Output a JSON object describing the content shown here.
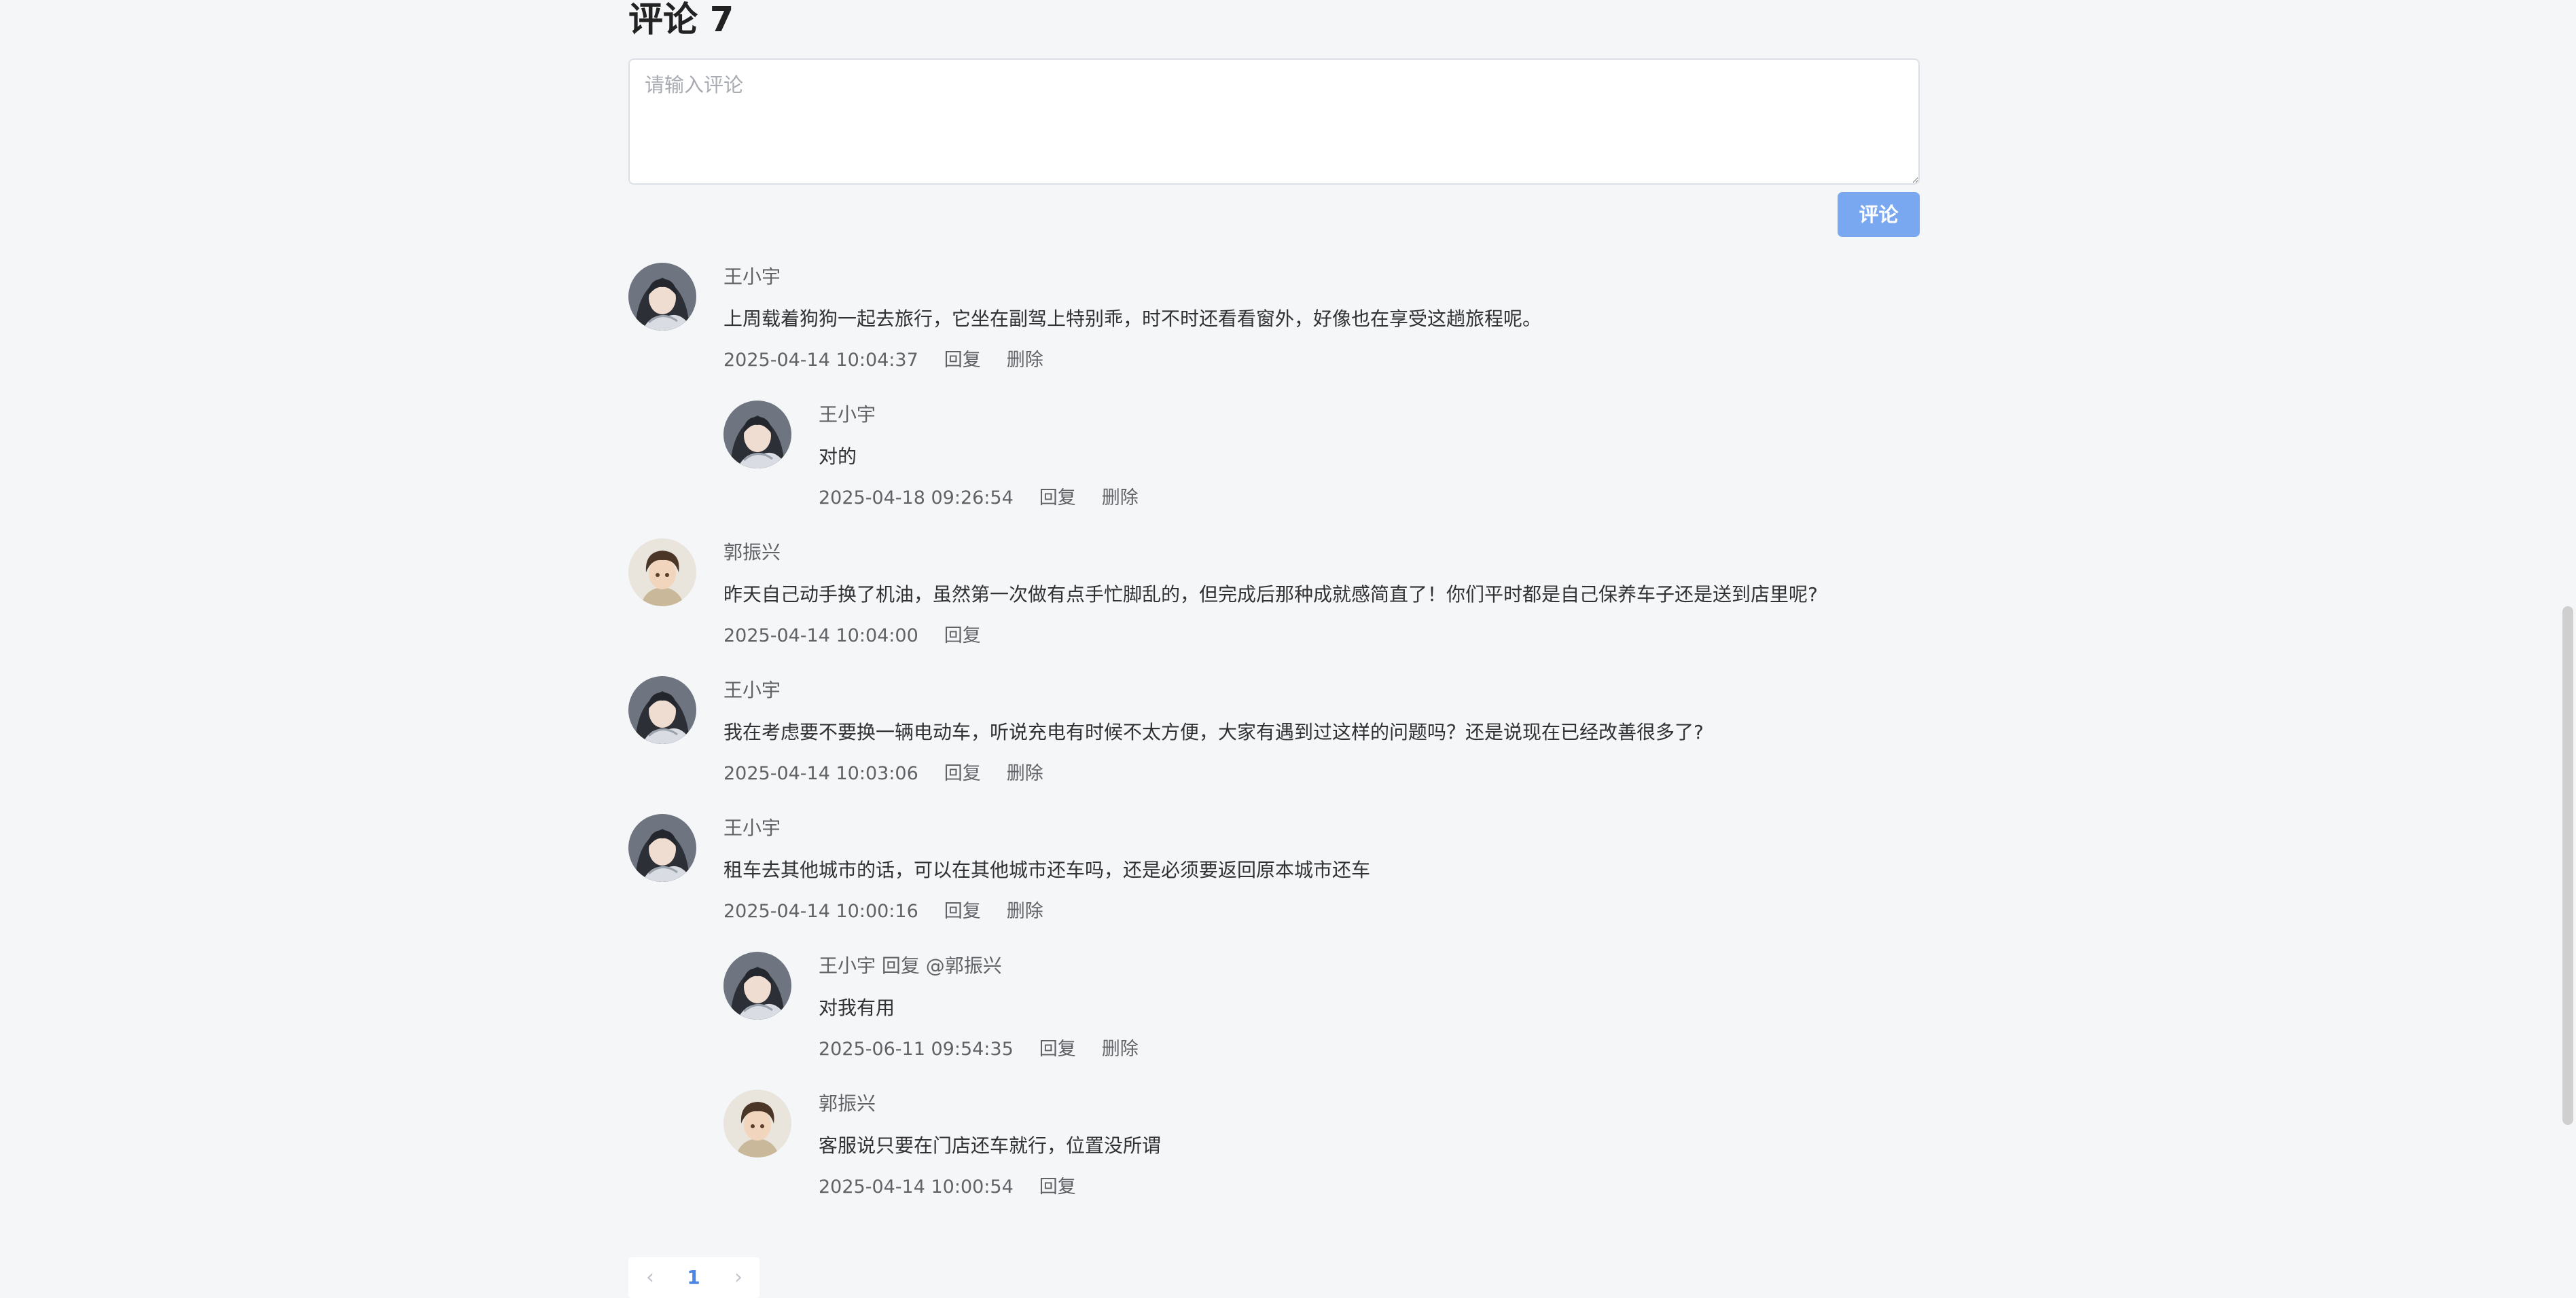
{
  "section": {
    "title": "评论 7"
  },
  "input": {
    "placeholder": "请输入评论",
    "submit_label": "评论"
  },
  "comments": [
    {
      "author": "王小宇",
      "text": "上周载着狗狗一起去旅行，它坐在副驾上特别乖，时不时还看看窗外，好像也在享受这趟旅程呢。",
      "time": "2025-04-14 10:04:37",
      "reply_label": "回复",
      "delete_label": "删除",
      "avatar": "anime-girl-avatar"
    },
    {
      "author": "王小宇",
      "text": "对的",
      "time": "2025-04-18 09:26:54",
      "reply_label": "回复",
      "delete_label": "删除",
      "avatar": "anime-girl-avatar"
    },
    {
      "author": "郭振兴",
      "text": "昨天自己动手换了机油，虽然第一次做有点手忙脚乱的，但完成后那种成就感简直了！你们平时都是自己保养车子还是送到店里呢?",
      "time": "2025-04-14 10:04:00",
      "reply_label": "回复",
      "avatar": "anime-boy-avatar"
    },
    {
      "author": "王小宇",
      "text": "我在考虑要不要换一辆电动车，听说充电有时候不太方便，大家有遇到过这样的问题吗？还是说现在已经改善很多了?",
      "time": "2025-04-14 10:03:06",
      "reply_label": "回复",
      "delete_label": "删除",
      "avatar": "anime-girl-avatar"
    },
    {
      "author": "王小宇",
      "text": "租车去其他城市的话，可以在其他城市还车吗，还是必须要返回原本城市还车",
      "time": "2025-04-14 10:00:16",
      "reply_label": "回复",
      "delete_label": "删除",
      "avatar": "anime-girl-avatar"
    },
    {
      "author": "王小宇 回复 @郭振兴",
      "text": "对我有用",
      "time": "2025-06-11 09:54:35",
      "reply_label": "回复",
      "delete_label": "删除",
      "avatar": "anime-girl-avatar"
    },
    {
      "author": "郭振兴",
      "text": "客服说只要在门店还车就行，位置没所谓",
      "time": "2025-04-14 10:00:54",
      "reply_label": "回复",
      "avatar": "anime-boy-avatar"
    }
  ],
  "pagination": {
    "prev_icon": "chevron-left-icon",
    "current_page": "1",
    "next_icon": "chevron-right-icon",
    "active_color": "#4a87e8"
  },
  "colors": {
    "button": "#79a8f0",
    "background": "#f5f6f8"
  }
}
